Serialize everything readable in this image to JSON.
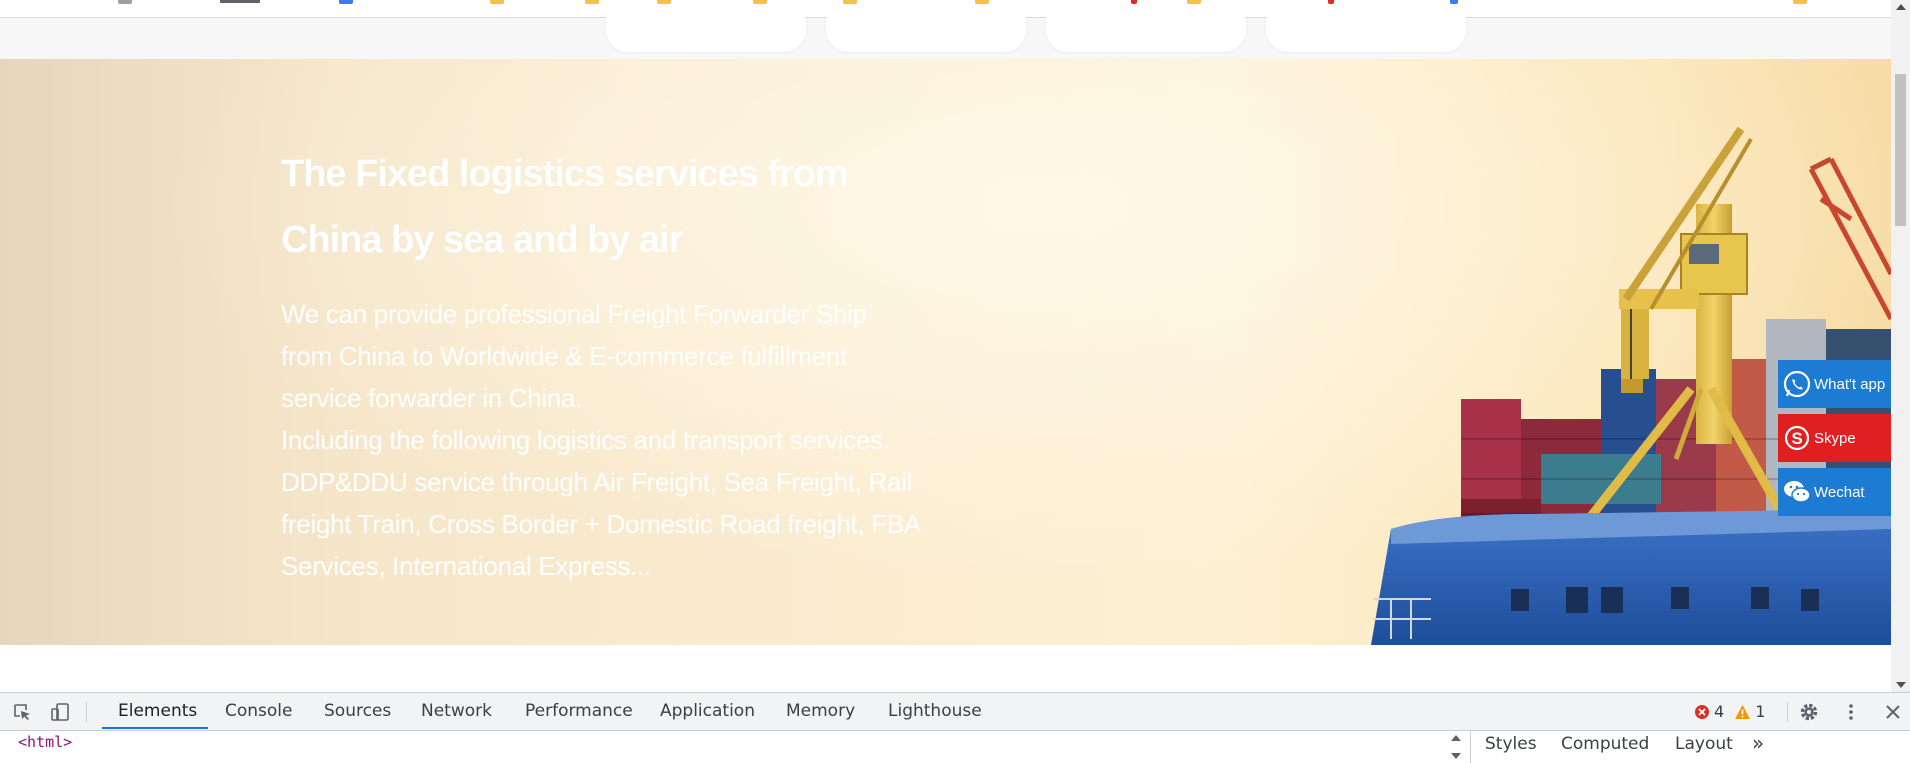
{
  "hero": {
    "title_line1": "The Fixed logistics services from",
    "title_line2": "China by sea and by air",
    "desc_lines": [
      "We can provide professional Freight Forwarder Ship",
      "from China to Worldwide & E-commerce fulfillment",
      "service forwarder in China.",
      "Including the following logistics and transport services.",
      "DDP&DDU service through Air Freight, Sea Freight, Rail",
      "freight Train, Cross Border + Domestic Road freight, FBA",
      "Services, International Express..."
    ]
  },
  "contact": {
    "whatsapp_label": "What't app",
    "skype_label": "Skype",
    "wechat_label": "Wechat",
    "whatsapp_color": "#1e7bd4",
    "skype_color": "#e02020",
    "wechat_color": "#1e7bd4"
  },
  "devtools": {
    "tabs": [
      "Elements",
      "Console",
      "Sources",
      "Network",
      "Performance",
      "Application",
      "Memory",
      "Lighthouse"
    ],
    "active_tab": "Elements",
    "error_count": "4",
    "warning_count": "1",
    "root_tag": "<html>",
    "side_tabs": [
      "Styles",
      "Computed",
      "Layout"
    ],
    "more_tabs_glyph": "»",
    "accent_color": "#1a73e8"
  },
  "icons": {
    "inspect": "inspect-element-icon",
    "device": "device-toolbar-icon",
    "error": "error-icon",
    "warning": "warning-icon",
    "settings": "gear-icon",
    "more": "kebab-menu-icon",
    "close": "close-icon"
  }
}
